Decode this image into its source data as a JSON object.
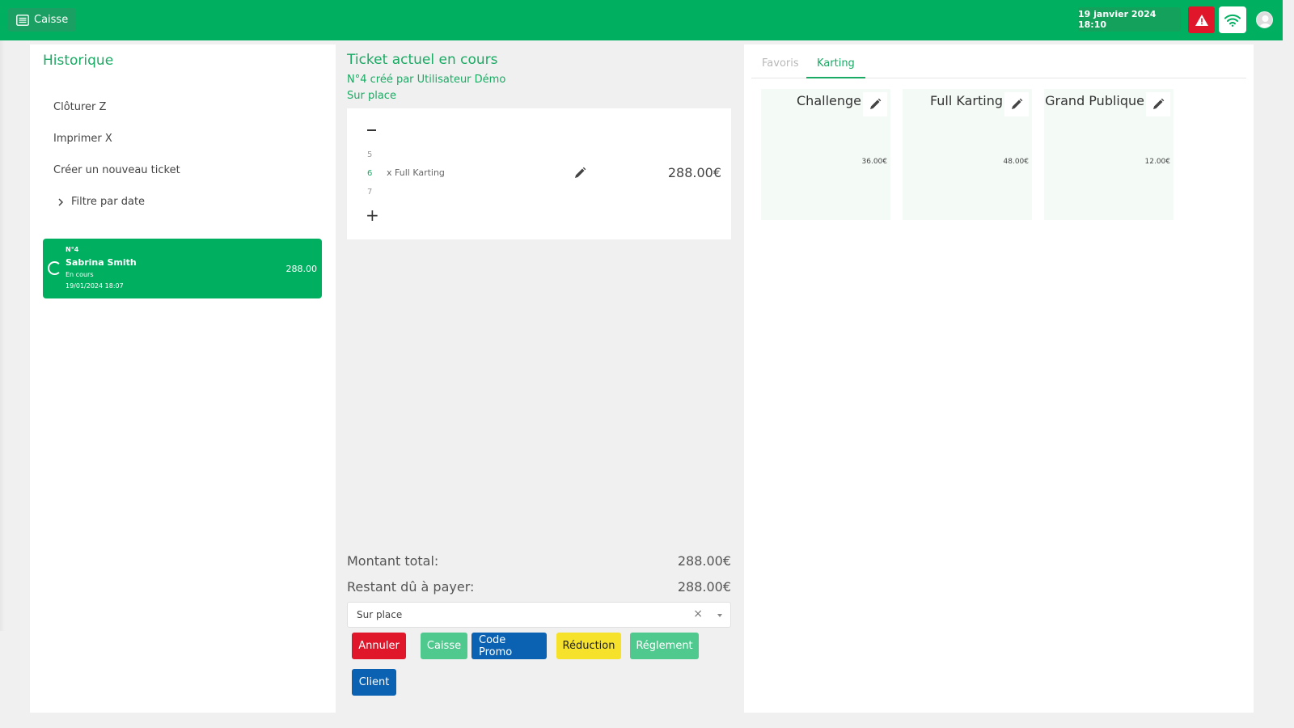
{
  "header": {
    "app_label": "Caisse",
    "datetime": "19 janvier 2024 18:10",
    "colors": {
      "primary": "#00b060",
      "alert": "#e0162b"
    }
  },
  "history": {
    "title": "Historique",
    "menu": [
      "Clôturer Z",
      "Imprimer X",
      "Créer un nouveau ticket"
    ],
    "filter_label": "Filtre par date",
    "tickets": [
      {
        "number": "N°4",
        "customer": "Sabrina Smith",
        "status": "En cours",
        "date": "19/01/2024 18:07",
        "amount": "288.00"
      }
    ]
  },
  "ticket": {
    "title": "Ticket actuel en cours",
    "subtitle": "N°4 créé par Utilisateur Démo",
    "mode": "Sur place",
    "line": {
      "qty_prev": "5",
      "qty": "6",
      "qty_next": "7",
      "label": "x Full Karting",
      "price": "288.00€"
    },
    "total_label": "Montant total:",
    "total_value": "288.00€",
    "remaining_label": "Restant dû à payer:",
    "remaining_value": "288.00€",
    "select_value": "Sur place",
    "buttons": {
      "annuler": "Annuler",
      "caisse": "Caisse",
      "code_promo": "Code Promo",
      "reduction": "Réduction",
      "reglement": "Réglement",
      "client": "Client"
    }
  },
  "catalog": {
    "tabs": [
      "Favoris",
      "Karting"
    ],
    "active_tab": "Karting",
    "products": [
      {
        "name": "Challenge",
        "price": "36.00€"
      },
      {
        "name": "Full Karting",
        "price": "48.00€"
      },
      {
        "name": "Grand Publique",
        "price": "12.00€"
      }
    ]
  }
}
